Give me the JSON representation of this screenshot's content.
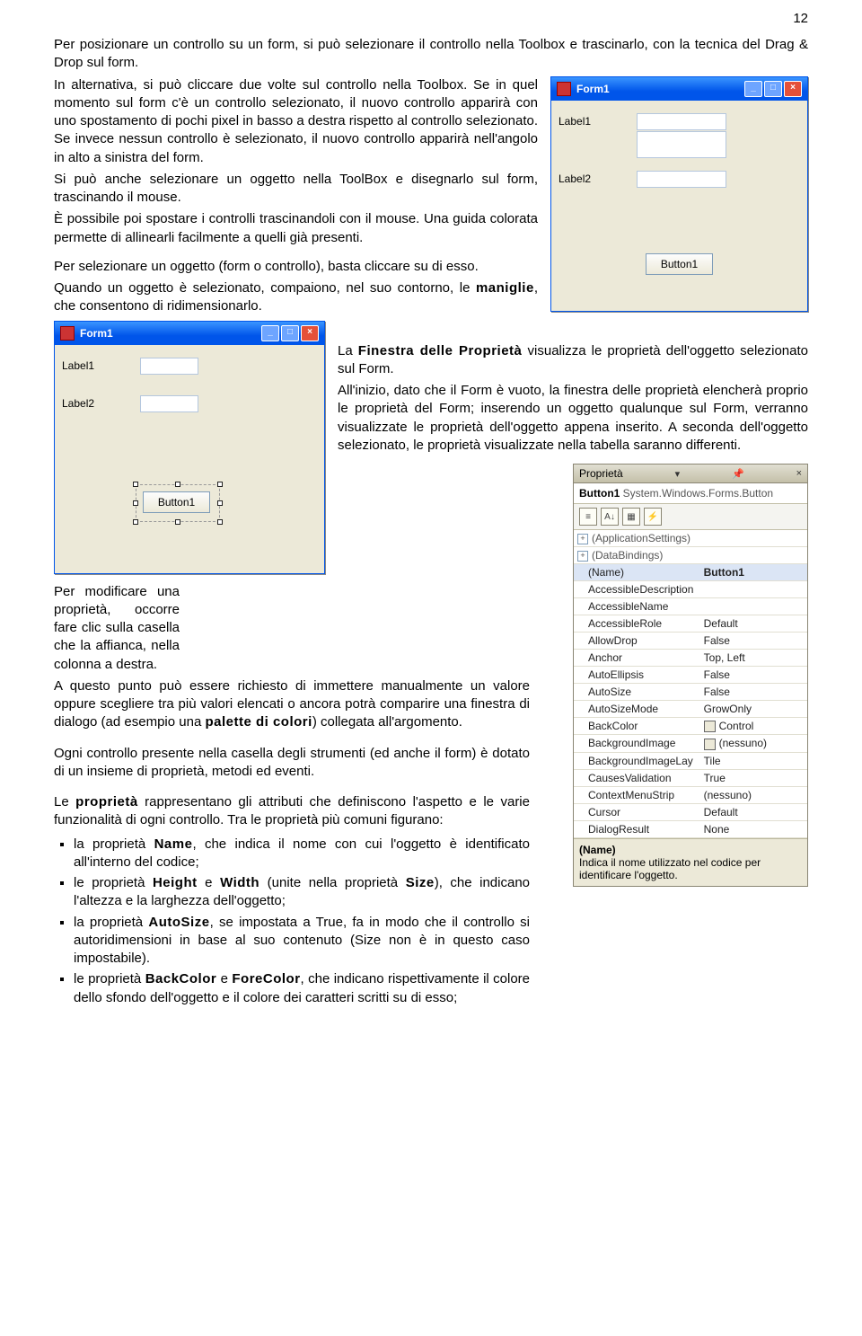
{
  "page_number": "12",
  "paragraphs": {
    "p1": "Per posizionare un controllo su un form, si può selezionare il controllo nella Toolbox e trascinarlo, con la tecnica del Drag & Drop sul form.",
    "p2_pre": "In alternativa, si può cliccare due volte sul controllo nella Toolbox. Se in quel momento sul form c'è un controllo selezionato, il nuovo controllo apparirà con uno spostamento di pochi pixel in basso a destra rispetto al controllo selezionato. Se invece nessun controllo è selezionato, il nuovo controllo apparirà nell'angolo in alto a sinistra del form.",
    "p3": "Si può anche selezionare un oggetto nella ToolBox e disegnarlo sul form, trascinando il mouse.",
    "p4": "È possibile poi spostare i controlli trascinandoli con il mouse. Una guida colorata permette di allinearli facilmente a quelli già presenti.",
    "p5": "Per selezionare un oggetto (form o controllo), basta cliccare su di esso.",
    "p6a": "Quando un oggetto è selezionato, compaiono, nel suo contorno, le ",
    "p6b_strong": "maniglie",
    "p6c": ", che consentono di ridimensionarlo.",
    "p7a": "La ",
    "p7b_strong": "Finestra delle Proprietà",
    "p7c": " visualizza le proprietà dell'oggetto selezionato sul Form.",
    "p8": "All'inizio, dato che il Form è vuoto, la finestra delle proprietà elencherà proprio le proprietà del Form; inserendo un oggetto qualunque sul Form, verranno visualizzate le proprietà dell'oggetto appena inserito. A seconda dell'oggetto selezionato, le proprietà visualizzate nella tabella saranno differenti.",
    "p9": "Per modificare una proprietà, occorre fare clic sulla casella che la affianca, nella colonna a destra.",
    "p10a": "A questo punto può essere richiesto di immettere manualmente un valore oppure scegliere tra più valori elencati o ancora potrà comparire una finestra di dialogo (ad esempio una ",
    "p10b_strong": "palette di colori",
    "p10c": ") collegata all'argomento.",
    "p11": "Ogni controllo presente nella casella degli strumenti (ed anche il form) è dotato di un insieme di proprietà, metodi ed eventi.",
    "p12a": "Le ",
    "p12b_strong": "proprietà",
    "p12c": " rappresentano gli attributi che definiscono l'aspetto e le varie funzionalità di ogni controllo. Tra le proprietà più comuni figurano:"
  },
  "bullets": {
    "b1a": "la proprietà ",
    "b1b_strong": "Name",
    "b1c": ", che indica il nome con cui l'oggetto è identificato all'interno del codice;",
    "b2a": "le proprietà ",
    "b2b_strong": "Height",
    "b2c": " e ",
    "b2d_strong": "Width",
    "b2e": " (unite nella proprietà ",
    "b2f_strong": "Size",
    "b2g": "), che indicano l'altezza e la larghezza dell'oggetto;",
    "b3a": "la proprietà ",
    "b3b_strong": "AutoSize",
    "b3c": ", se impostata a True, fa in modo che il controllo si autoridimensioni in base al suo contenuto (Size non è in questo caso impostabile).",
    "b4a": "le proprietà ",
    "b4b_strong": "BackColor",
    "b4c": " e ",
    "b4d_strong": "ForeColor",
    "b4e": ", che indicano rispettivamente il colore dello sfondo dell'oggetto e il colore dei caratteri scritti su di esso;"
  },
  "form1": {
    "title": "Form1",
    "label1": "Label1",
    "label2": "Label2",
    "button": "Button1"
  },
  "properties_panel": {
    "title": "Proprietà",
    "subtitle_name": "Button1",
    "subtitle_type": "System.Windows.Forms.Button",
    "rows": [
      {
        "expander": true,
        "name": "(ApplicationSettings)",
        "value": ""
      },
      {
        "expander": true,
        "name": "(DataBindings)",
        "value": ""
      },
      {
        "selected": true,
        "name": "(Name)",
        "value": "Button1"
      },
      {
        "name": "AccessibleDescription",
        "value": ""
      },
      {
        "name": "AccessibleName",
        "value": ""
      },
      {
        "name": "AccessibleRole",
        "value": "Default"
      },
      {
        "name": "AllowDrop",
        "value": "False"
      },
      {
        "name": "Anchor",
        "value": "Top, Left"
      },
      {
        "name": "AutoEllipsis",
        "value": "False"
      },
      {
        "name": "AutoSize",
        "value": "False"
      },
      {
        "name": "AutoSizeMode",
        "value": "GrowOnly"
      },
      {
        "name": "BackColor",
        "value": "Control",
        "swatch": true
      },
      {
        "name": "BackgroundImage",
        "value": "(nessuno)",
        "swatch": true
      },
      {
        "name": "BackgroundImageLay",
        "value": "Tile"
      },
      {
        "name": "CausesValidation",
        "value": "True"
      },
      {
        "name": "ContextMenuStrip",
        "value": "(nessuno)"
      },
      {
        "name": "Cursor",
        "value": "Default"
      },
      {
        "name": "DialogResult",
        "value": "None"
      }
    ],
    "help_title": "(Name)",
    "help_text": "Indica il nome utilizzato nel codice per identificare l'oggetto."
  }
}
